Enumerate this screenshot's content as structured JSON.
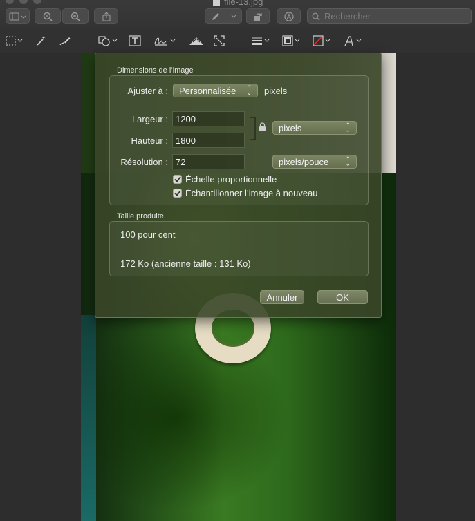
{
  "window": {
    "title": "file-13.jpg"
  },
  "toolbar": {
    "search_placeholder": "Rechercher",
    "icons": [
      "sidebar-icon",
      "zoom-out-icon",
      "zoom-in-icon",
      "share-icon",
      "markup-pen-icon",
      "rotate-icon",
      "annotate-circle-icon",
      "search-icon"
    ]
  },
  "markup_toolbar": {
    "tools": [
      "rect-selection",
      "instant-alpha",
      "sketch",
      "shapes",
      "text",
      "sign",
      "adjust-color",
      "adjust-size",
      "shape-style",
      "border-color",
      "fill-color",
      "text-style"
    ]
  },
  "dialog": {
    "dimensions_title": "Dimensions de l’image",
    "fit_label": "Ajuster à :",
    "fit_value": "Personnalisée",
    "fit_unit": "pixels",
    "width_label": "Largeur :",
    "width_value": "1200",
    "height_label": "Hauteur :",
    "height_value": "1800",
    "size_unit": "pixels",
    "resolution_label": "Résolution :",
    "resolution_value": "72",
    "resolution_unit": "pixels/pouce",
    "scale_proportionally": "Échelle proportionnelle",
    "resample": "Échantillonner l’image à nouveau",
    "result_title": "Taille produite",
    "result_percent": "100 pour cent",
    "result_size": "172 Ko (ancienne taille : 131 Ko)",
    "cancel_label": "Annuler",
    "ok_label": "OK"
  }
}
